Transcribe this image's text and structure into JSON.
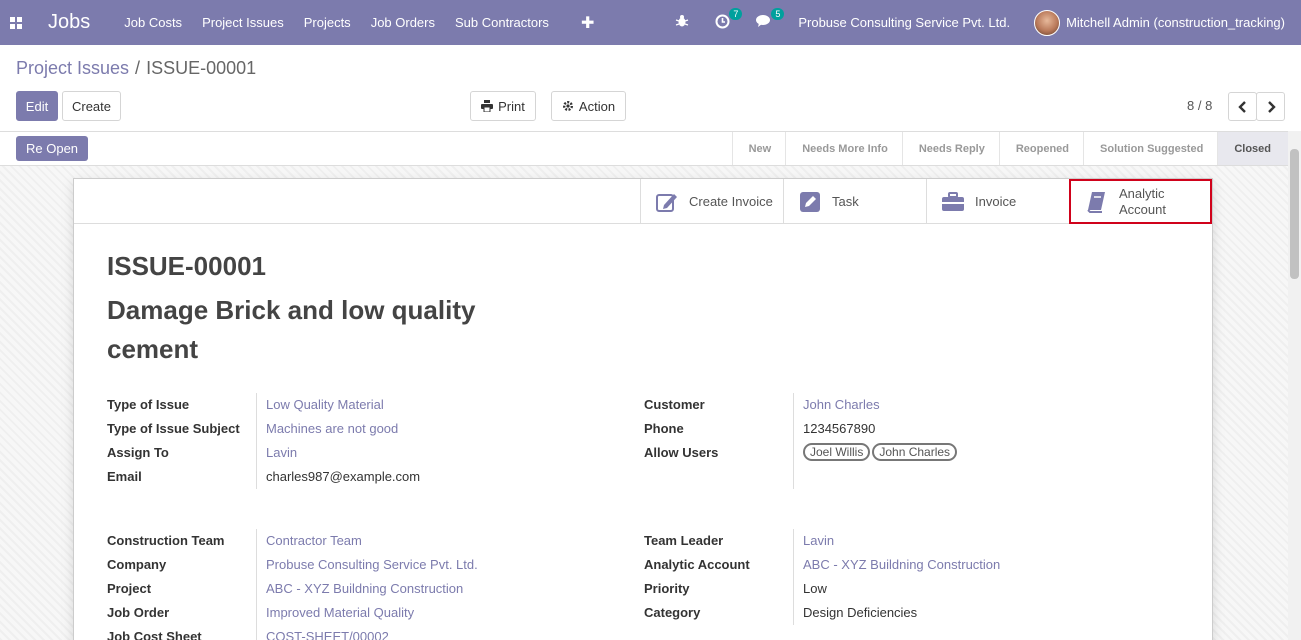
{
  "navbar": {
    "brand": "Jobs",
    "menu": [
      "Job Costs",
      "Project Issues",
      "Projects",
      "Job Orders",
      "Sub Contractors"
    ],
    "activity_count": "7",
    "messages_count": "5",
    "company": "Probuse Consulting Service Pvt. Ltd.",
    "user": "Mitchell Admin (construction_tracking)"
  },
  "breadcrumb": {
    "parent": "Project Issues",
    "separator": "/",
    "current": "ISSUE-00001"
  },
  "controls": {
    "edit": "Edit",
    "create": "Create",
    "print": "Print",
    "action": "Action",
    "pager": "8 / 8"
  },
  "statusbar": {
    "reopen": "Re Open",
    "stages": [
      "New",
      "Needs More Info",
      "Needs Reply",
      "Reopened",
      "Solution Suggested",
      "Closed"
    ],
    "active_stage": "Closed"
  },
  "smart_buttons": {
    "create_invoice": "Create Invoice",
    "task": "Task",
    "invoice": "Invoice",
    "analytic_line1": "Analytic",
    "analytic_line2": "Account"
  },
  "issue": {
    "number": "ISSUE-00001",
    "title": "Damage Brick and low quality cement"
  },
  "fields": {
    "type_of_issue": {
      "label": "Type of Issue",
      "value": "Low Quality Material"
    },
    "type_of_issue_subject": {
      "label": "Type of Issue Subject",
      "value": "Machines are not good"
    },
    "assign_to": {
      "label": "Assign To",
      "value": "Lavin"
    },
    "email": {
      "label": "Email",
      "value": "charles987@example.com"
    },
    "customer": {
      "label": "Customer",
      "value": "John Charles"
    },
    "phone": {
      "label": "Phone",
      "value": "1234567890"
    },
    "allow_users": {
      "label": "Allow Users",
      "tags": [
        "Joel Willis",
        "John Charles"
      ]
    },
    "construction_team": {
      "label": "Construction Team",
      "value": "Contractor Team"
    },
    "company": {
      "label": "Company",
      "value": "Probuse Consulting Service Pvt. Ltd."
    },
    "project": {
      "label": "Project",
      "value": "ABC - XYZ Buildning Construction"
    },
    "job_order": {
      "label": "Job Order",
      "value": "Improved Material Quality"
    },
    "job_cost_sheet": {
      "label": "Job Cost Sheet",
      "value": "COST-SHEET/00002"
    },
    "team_leader": {
      "label": "Team Leader",
      "value": "Lavin"
    },
    "analytic_account": {
      "label": "Analytic Account",
      "value": "ABC - XYZ Buildning Construction"
    },
    "priority": {
      "label": "Priority",
      "value": "Low"
    },
    "category": {
      "label": "Category",
      "value": "Design Deficiencies"
    }
  },
  "colors": {
    "brand": "#7c7bad",
    "highlight_border": "#d0021b",
    "badge": "#00a09d"
  }
}
